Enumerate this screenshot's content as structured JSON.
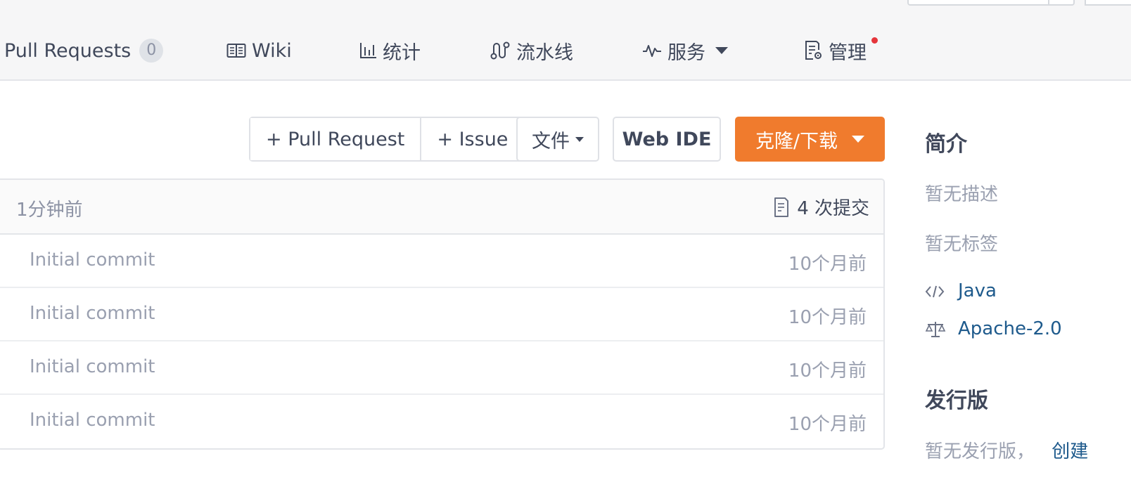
{
  "nav": {
    "tabs": [
      {
        "label": "Pull Requests",
        "badge": "0",
        "icon": "pull-request-icon"
      },
      {
        "label": "Wiki",
        "icon": "wiki-book-icon"
      },
      {
        "label": "统计",
        "icon": "bar-chart-icon"
      },
      {
        "label": "流水线",
        "icon": "pipeline-icon"
      },
      {
        "label": "服务",
        "icon": "pulse-icon",
        "dropdown": true
      },
      {
        "label": "管理",
        "icon": "settings-doc-icon",
        "notification": true
      }
    ]
  },
  "actions": {
    "pull_request": "+ Pull Request",
    "issue": "+ Issue",
    "files": "文件",
    "web_ide": "Web IDE",
    "clone": "克隆/下载"
  },
  "repo": {
    "last_updated": "1分钟前",
    "commits_label": "4 次提交",
    "rows": [
      {
        "message": "Initial commit",
        "time": "10个月前"
      },
      {
        "message": "Initial commit",
        "time": "10个月前"
      },
      {
        "message": "Initial commit",
        "time": "10个月前"
      },
      {
        "message": "Initial commit",
        "time": "10个月前"
      }
    ]
  },
  "sidebar": {
    "intro_title": "简介",
    "no_description": "暂无描述",
    "no_tags": "暂无标签",
    "language": "Java",
    "license": "Apache-2.0",
    "releases_title": "发行版",
    "no_releases": "暂无发行版，",
    "create_link": "创建"
  },
  "colors": {
    "accent_orange": "#f07b2d",
    "link_blue": "#1e5a8c",
    "notification_red": "#e5353b"
  }
}
